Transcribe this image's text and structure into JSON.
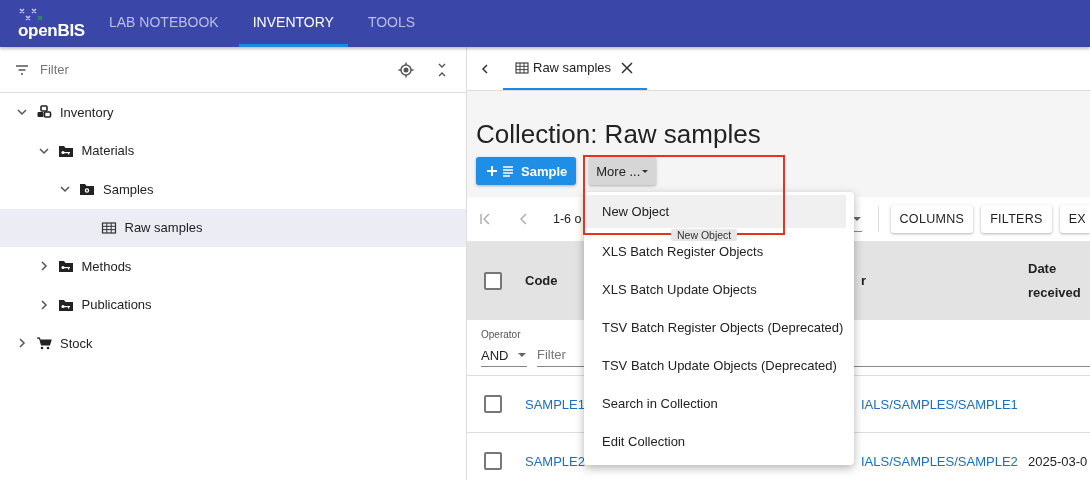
{
  "app": {
    "logo": "openBIS",
    "nav": [
      {
        "label": "LAB NOTEBOOK",
        "selected": false
      },
      {
        "label": "INVENTORY",
        "selected": true
      },
      {
        "label": "TOOLS",
        "selected": false
      }
    ]
  },
  "sidebar": {
    "filter": {
      "placeholder": "Filter"
    },
    "tree": [
      {
        "label": "Inventory",
        "kind": "boxes",
        "expanded": true,
        "selected": false,
        "children": [
          {
            "label": "Materials",
            "kind": "folder-key",
            "expanded": true,
            "selected": false,
            "children": [
              {
                "label": "Samples",
                "kind": "folder-gear",
                "expanded": true,
                "selected": false,
                "children": [
                  {
                    "label": "Raw samples",
                    "kind": "table",
                    "selected": true
                  }
                ]
              }
            ]
          },
          {
            "label": "Methods",
            "kind": "folder-key",
            "expanded": false,
            "selected": false
          },
          {
            "label": "Publications",
            "kind": "folder-key",
            "expanded": false,
            "selected": false
          }
        ]
      },
      {
        "label": "Stock",
        "kind": "cart",
        "expanded": false,
        "selected": false
      }
    ]
  },
  "tabs": [
    {
      "label": "Raw samples",
      "selected": true
    }
  ],
  "page": {
    "title": "Collection: Raw samples",
    "buttons": [
      {
        "kind": "primary",
        "label": "Sample"
      },
      {
        "kind": "dropdown",
        "label": "More ..."
      }
    ]
  },
  "grid": {
    "pager": {
      "range": "1-6 o"
    },
    "toolbar_buttons": [
      "COLUMNS",
      "FILTERS",
      "EX"
    ],
    "select_all": {
      "checked": false
    },
    "columns": [
      {
        "label": "Code"
      },
      {
        "label": "r"
      },
      {
        "label": "Date received"
      }
    ],
    "filter": {
      "operator_label": "Operator",
      "operator": "AND",
      "placeholder": "Filter"
    },
    "rows": [
      {
        "selected": false,
        "cells": [
          "SAMPLE1",
          "IALS/SAMPLES/SAMPLE1"
        ]
      },
      {
        "selected": false,
        "cells": [
          "SAMPLE2",
          "IALS/SAMPLES/SAMPLE2",
          "2025-03-0"
        ]
      }
    ]
  },
  "menu": {
    "items": [
      {
        "label": "New Object",
        "highlighted": true
      },
      {
        "label": "XLS Batch Register Objects",
        "highlighted": false
      },
      {
        "label": "XLS Batch Update Objects",
        "highlighted": false
      },
      {
        "label": "TSV Batch Register Objects (Deprecated)",
        "highlighted": false
      },
      {
        "label": "TSV Batch Update Objects (Deprecated)",
        "highlighted": false
      },
      {
        "label": "Search in Collection",
        "highlighted": false
      },
      {
        "label": "Edit Collection",
        "highlighted": false
      }
    ],
    "tooltip": "New Object"
  }
}
